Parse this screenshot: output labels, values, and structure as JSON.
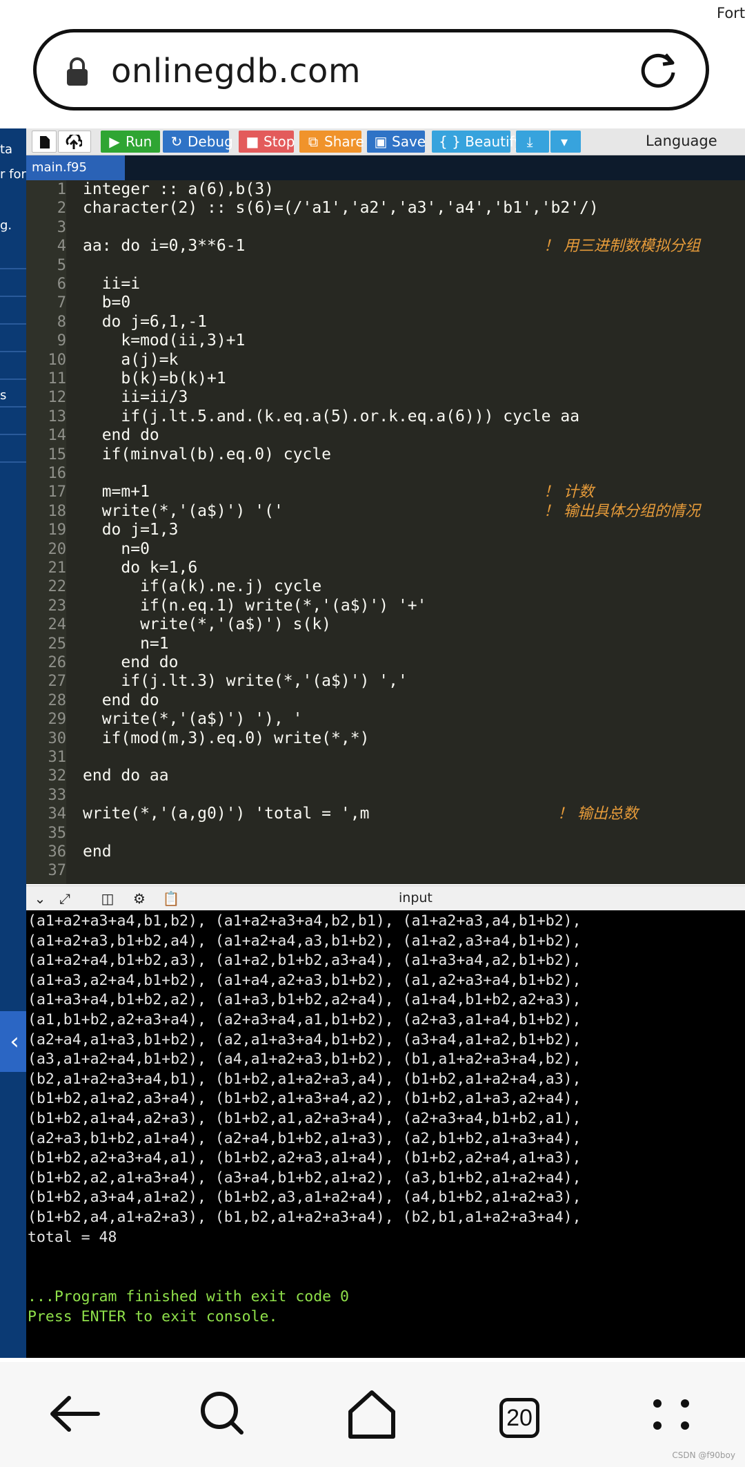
{
  "browser": {
    "url": "onlinegdb.com"
  },
  "sidebar_fragments": [
    "ta",
    "r for",
    "g.",
    "s"
  ],
  "toolbar": {
    "run": "Run",
    "debug": "Debug",
    "stop": "Stop",
    "share": "Share",
    "save": "Save",
    "beautify": "{ } Beautify",
    "language_label": "Language",
    "language_value": "Fort",
    "colors": {
      "run": "#2fa533",
      "debug": "#2f73c6",
      "stop": "#e35b5b",
      "share": "#f0932b",
      "save": "#2f73c6",
      "beautify": "#37a3dd",
      "download": "#37a3dd"
    }
  },
  "tab": {
    "filename": "main.f95"
  },
  "editor": {
    "lines": [
      {
        "n": "1",
        "code": "integer :: a(6),b(3)",
        "comment": ""
      },
      {
        "n": "2",
        "code": "character(2) :: s(6)=(/'a1','a2','a3','a4','b1','b2'/)",
        "comment": ""
      },
      {
        "n": "3",
        "code": "",
        "comment": ""
      },
      {
        "n": "4",
        "code": "aa: do i=0,3**6-1",
        "comment": "！ 用三进制数模拟分组"
      },
      {
        "n": "5",
        "code": "",
        "comment": ""
      },
      {
        "n": "6",
        "code": "  ii=i",
        "comment": ""
      },
      {
        "n": "7",
        "code": "  b=0",
        "comment": ""
      },
      {
        "n": "8",
        "code": "  do j=6,1,-1",
        "comment": ""
      },
      {
        "n": "9",
        "code": "    k=mod(ii,3)+1",
        "comment": ""
      },
      {
        "n": "10",
        "code": "    a(j)=k",
        "comment": ""
      },
      {
        "n": "11",
        "code": "    b(k)=b(k)+1",
        "comment": ""
      },
      {
        "n": "12",
        "code": "    ii=ii/3",
        "comment": ""
      },
      {
        "n": "13",
        "code": "    if(j.lt.5.and.(k.eq.a(5).or.k.eq.a(6))) cycle aa",
        "comment": ""
      },
      {
        "n": "14",
        "code": "  end do",
        "comment": ""
      },
      {
        "n": "15",
        "code": "  if(minval(b).eq.0) cycle",
        "comment": ""
      },
      {
        "n": "16",
        "code": "",
        "comment": ""
      },
      {
        "n": "17",
        "code": "  m=m+1",
        "comment": "！ 计数"
      },
      {
        "n": "18",
        "code": "  write(*,'(a$)') '('",
        "comment": "！ 输出具体分组的情况"
      },
      {
        "n": "19",
        "code": "  do j=1,3",
        "comment": ""
      },
      {
        "n": "20",
        "code": "    n=0",
        "comment": ""
      },
      {
        "n": "21",
        "code": "    do k=1,6",
        "comment": ""
      },
      {
        "n": "22",
        "code": "      if(a(k).ne.j) cycle",
        "comment": ""
      },
      {
        "n": "23",
        "code": "      if(n.eq.1) write(*,'(a$)') '+'",
        "comment": ""
      },
      {
        "n": "24",
        "code": "      write(*,'(a$)') s(k)",
        "comment": ""
      },
      {
        "n": "25",
        "code": "      n=1",
        "comment": ""
      },
      {
        "n": "26",
        "code": "    end do",
        "comment": ""
      },
      {
        "n": "27",
        "code": "    if(j.lt.3) write(*,'(a$)') ','",
        "comment": ""
      },
      {
        "n": "28",
        "code": "  end do",
        "comment": ""
      },
      {
        "n": "29",
        "code": "  write(*,'(a$)') '), '",
        "comment": ""
      },
      {
        "n": "30",
        "code": "  if(mod(m,3).eq.0) write(*,*)",
        "comment": ""
      },
      {
        "n": "31",
        "code": "",
        "comment": ""
      },
      {
        "n": "32",
        "code": "end do aa",
        "comment": ""
      },
      {
        "n": "33",
        "code": "",
        "comment": ""
      },
      {
        "n": "34",
        "code": "write(*,'(a,g0)') 'total = ',m",
        "comment": "！ 输出总数"
      },
      {
        "n": "35",
        "code": "",
        "comment": ""
      },
      {
        "n": "36",
        "code": "end",
        "comment": ""
      },
      {
        "n": "37",
        "code": "",
        "comment": ""
      }
    ]
  },
  "output_panel": {
    "input_label": "input"
  },
  "console": {
    "lines": [
      "(a1+a2+a3+a4,b1,b2), (a1+a2+a3+a4,b2,b1), (a1+a2+a3,a4,b1+b2),",
      "(a1+a2+a3,b1+b2,a4), (a1+a2+a4,a3,b1+b2), (a1+a2,a3+a4,b1+b2),",
      "(a1+a2+a4,b1+b2,a3), (a1+a2,b1+b2,a3+a4), (a1+a3+a4,a2,b1+b2),",
      "(a1+a3,a2+a4,b1+b2), (a1+a4,a2+a3,b1+b2), (a1,a2+a3+a4,b1+b2),",
      "(a1+a3+a4,b1+b2,a2), (a1+a3,b1+b2,a2+a4), (a1+a4,b1+b2,a2+a3),",
      "(a1,b1+b2,a2+a3+a4), (a2+a3+a4,a1,b1+b2), (a2+a3,a1+a4,b1+b2),",
      "(a2+a4,a1+a3,b1+b2), (a2,a1+a3+a4,b1+b2), (a3+a4,a1+a2,b1+b2),",
      "(a3,a1+a2+a4,b1+b2), (a4,a1+a2+a3,b1+b2), (b1,a1+a2+a3+a4,b2),",
      "(b2,a1+a2+a3+a4,b1), (b1+b2,a1+a2+a3,a4), (b1+b2,a1+a2+a4,a3),",
      "(b1+b2,a1+a2,a3+a4), (b1+b2,a1+a3+a4,a2), (b1+b2,a1+a3,a2+a4),",
      "(b1+b2,a1+a4,a2+a3), (b1+b2,a1,a2+a3+a4), (a2+a3+a4,b1+b2,a1),",
      "(a2+a3,b1+b2,a1+a4), (a2+a4,b1+b2,a1+a3), (a2,b1+b2,a1+a3+a4),",
      "(b1+b2,a2+a3+a4,a1), (b1+b2,a2+a3,a1+a4), (b1+b2,a2+a4,a1+a3),",
      "(b1+b2,a2,a1+a3+a4), (a3+a4,b1+b2,a1+a2), (a3,b1+b2,a1+a2+a4),",
      "(b1+b2,a3+a4,a1+a2), (b1+b2,a3,a1+a2+a4), (a4,b1+b2,a1+a2+a3),",
      "(b1+b2,a4,a1+a2+a3), (b1,b2,a1+a2+a3+a4), (b2,b1,a1+a2+a3+a4),",
      "total = 48"
    ],
    "finish_lines": [
      "...Program finished with exit code 0",
      "Press ENTER to exit console."
    ]
  },
  "nav": {
    "tab_count": "20"
  },
  "watermark": "CSDN @f90boy"
}
